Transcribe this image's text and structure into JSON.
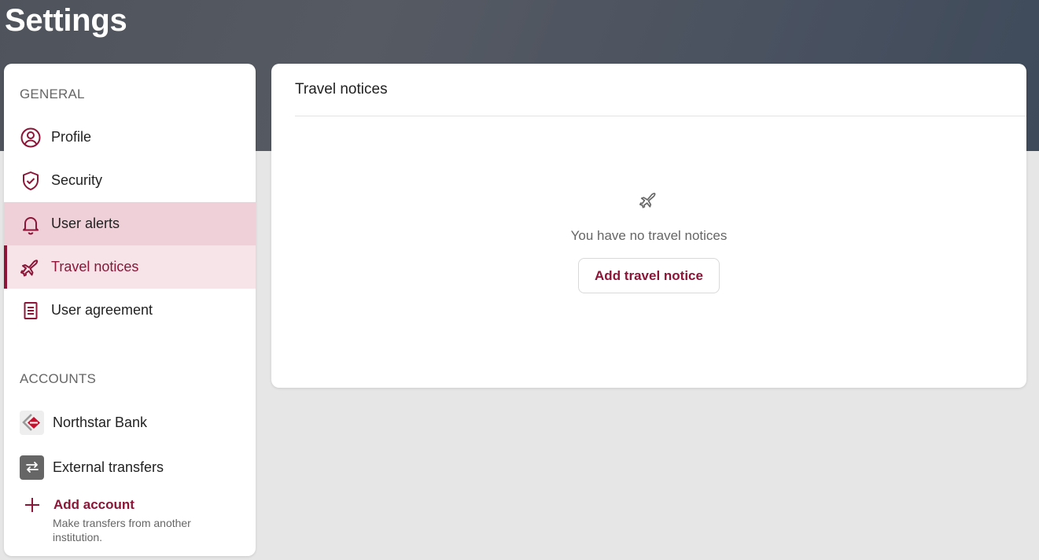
{
  "page": {
    "title": "Settings"
  },
  "sidebar": {
    "general_label": "GENERAL",
    "items": [
      {
        "label": "Profile",
        "icon": "person-circle-icon"
      },
      {
        "label": "Security",
        "icon": "shield-check-icon"
      },
      {
        "label": "User alerts",
        "icon": "bell-icon"
      },
      {
        "label": "Travel notices",
        "icon": "airplane-icon"
      },
      {
        "label": "User agreement",
        "icon": "document-icon"
      }
    ],
    "accounts_label": "ACCOUNTS",
    "accounts": [
      {
        "label": "Northstar Bank",
        "icon": "bank-logo"
      },
      {
        "label": "External transfers",
        "icon": "transfer-arrows-icon"
      }
    ],
    "add_account": {
      "label": "Add account",
      "description": "Make transfers from another institution."
    }
  },
  "main": {
    "title": "Travel notices",
    "empty_message": "You have no travel notices",
    "add_button": "Add travel notice"
  },
  "colors": {
    "accent": "#8c1538",
    "hover_bg": "#efcfd8",
    "active_bg": "#f7e4e9",
    "header_bg": "#4f535b",
    "page_bg": "#e6e6e6"
  }
}
